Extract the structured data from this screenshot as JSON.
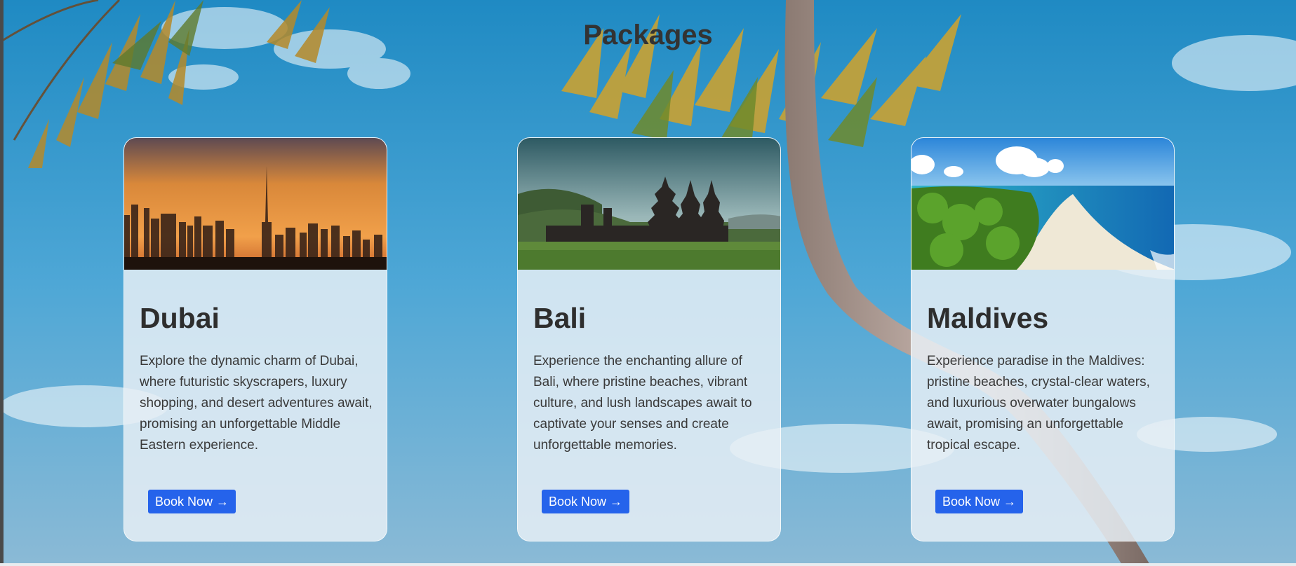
{
  "section": {
    "title": "Packages"
  },
  "packages": [
    {
      "name": "Dubai",
      "description": "Explore the dynamic charm of Dubai, where futuristic skyscrapers, luxury shopping, and desert adventures await, promising an unforgettable Middle Eastern experience.",
      "button_label": "Book Now →",
      "image": "dubai-skyline-sunset"
    },
    {
      "name": "Bali",
      "description": "Experience the enchanting allure of Bali, where pristine beaches, vibrant culture, and lush landscapes await to captivate your senses and create unforgettable memories.",
      "button_label": "Book Now →",
      "image": "bali-temple-landscape"
    },
    {
      "name": "Maldives",
      "description": "Experience paradise in the Maldives: pristine beaches, crystal-clear waters, and luxurious overwater bungalows await, promising an unforgettable tropical escape.",
      "button_label": "Book Now →",
      "image": "maldives-beach-aerial"
    }
  ],
  "colors": {
    "button": "#2563eb",
    "text": "#333333",
    "sky": "#2f93c6"
  }
}
